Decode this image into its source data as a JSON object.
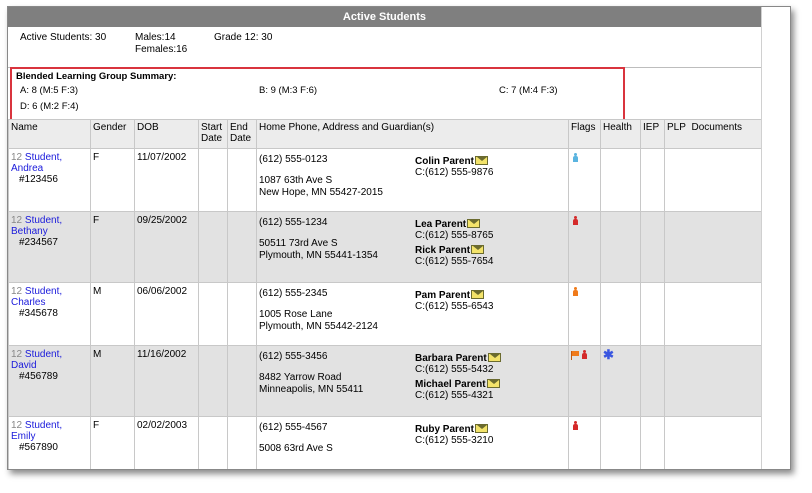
{
  "title": "Active Students",
  "summary": {
    "active": "Active Students: 30",
    "males": "Males:14",
    "females": "Females:16",
    "grade": "Grade 12: 30"
  },
  "blended": {
    "title": "Blended Learning Group Summary:",
    "a": "A: 8 (M:5   F:3)",
    "b": "B: 9 (M:3   F:6)",
    "c": "C: 7 (M:4   F:3)",
    "d": "D: 6 (M:2   F:4)"
  },
  "columns": {
    "name": "Name",
    "gender": "Gender",
    "dob": "DOB",
    "start": "Start Date",
    "end": "End Date",
    "home": "Home Phone, Address and Guardian(s)",
    "flags": "Flags",
    "health": "Health",
    "iep": "IEP",
    "plp": "PLP",
    "documents": "Documents"
  },
  "students": [
    {
      "grade": "12",
      "name_line1": "Student,",
      "name_line2": "Andrea",
      "id": "#123456",
      "gender": "F",
      "dob": "11/07/2002",
      "phone": "(612) 555-0123",
      "addr1": "1087 63th Ave S",
      "addr2": "New Hope, MN 55427-2015",
      "guardians": [
        {
          "name": "Colin Parent",
          "cell": "C:(612) 555-9876"
        }
      ]
    },
    {
      "grade": "12",
      "name_line1": "Student,",
      "name_line2": "Bethany",
      "id": "#234567",
      "gender": "F",
      "dob": "09/25/2002",
      "phone": "(612) 555-1234",
      "addr1": "50511 73rd Ave S",
      "addr2": "Plymouth, MN 55441-1354",
      "guardians": [
        {
          "name": "Lea Parent",
          "cell": "C:(612) 555-8765"
        },
        {
          "name": "Rick Parent",
          "cell": "C:(612) 555-7654"
        }
      ]
    },
    {
      "grade": "12",
      "name_line1": "Student,",
      "name_line2": "Charles",
      "id": "#345678",
      "gender": "M",
      "dob": "06/06/2002",
      "phone": "(612) 555-2345",
      "addr1": "1005 Rose Lane",
      "addr2": "Plymouth, MN 55442-2124",
      "guardians": [
        {
          "name": "Pam Parent",
          "cell": "C:(612) 555-6543"
        }
      ]
    },
    {
      "grade": "12",
      "name_line1": "Student,",
      "name_line2": "David",
      "id": "#456789",
      "gender": "M",
      "dob": "11/16/2002",
      "phone": "(612) 555-3456",
      "addr1": "8482 Yarrow Road",
      "addr2": "Minneapolis, MN 55411",
      "guardians": [
        {
          "name": "Barbara Parent",
          "cell": "C:(612) 555-5432"
        },
        {
          "name": "Michael Parent",
          "cell": "C:(612) 555-4321"
        }
      ]
    },
    {
      "grade": "12",
      "name_line1": "Student,",
      "name_line2": "Emily",
      "id": "#567890",
      "gender": "F",
      "dob": "02/02/2003",
      "phone": "(612) 555-4567",
      "addr1": "5008 63rd Ave S",
      "addr2": "",
      "guardians": [
        {
          "name": "Ruby Parent",
          "cell": "C:(612) 555-3210"
        }
      ]
    }
  ],
  "icons": {
    "flag_colors": {
      "light_blue": "#5ab4e0",
      "red": "#d42a2a",
      "orange": "#f07a1a"
    },
    "health_symbol": "✱",
    "envelope": "envelope-icon"
  },
  "colors": {
    "header_bar": "#7f7f7f",
    "alt_row": "#e2e2e2",
    "highlight_border": "#d9343e",
    "link": "#1a1adb"
  }
}
